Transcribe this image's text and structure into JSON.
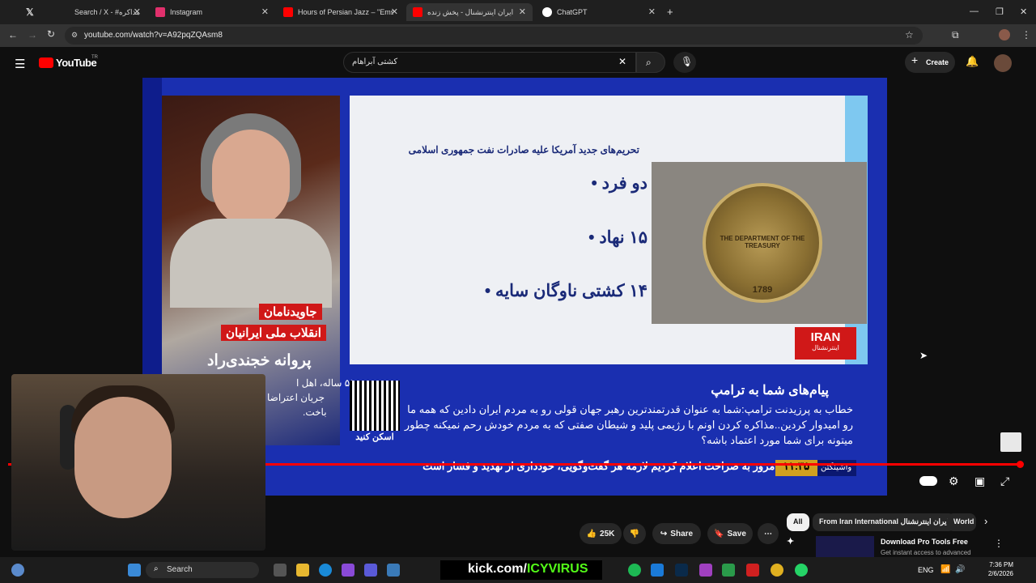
{
  "browser": {
    "tabs": [
      {
        "title": "Search / X - #مذاکره",
        "color": "#000000"
      },
      {
        "title": "Instagram",
        "color": "#e1306c"
      },
      {
        "title": "Hours of Persian Jazz – \"Emsha",
        "color": "#ff0000"
      },
      {
        "title": "ایران اینترنشنال - پخش زنده",
        "color": "#ff0000"
      },
      {
        "title": "ChatGPT",
        "color": "#ffffff"
      }
    ],
    "url": "youtube.com/watch?v=A92pqZQAsm8"
  },
  "youtube": {
    "logo": "YouTube",
    "region": "TR",
    "search_value": "کشتی آبراهام",
    "create_label": "Create"
  },
  "video": {
    "host_labels": [
      "جاویدنامان",
      "انقلاب ملی ایرانیان"
    ],
    "host_name": "پروانه خجندی‌راد",
    "host_caption": [
      "۵۱ ساله، اهل ا",
      "جریان اعتراضا",
      "باخت."
    ],
    "slide_subtitle": "تحریم‌های جدید آمریکا علیه صادرات نفت جمهوری اسلامی",
    "bullets": [
      "دو فرد •",
      "۱۵ نهاد •",
      "۱۴ کشتی ناوگان سایه •"
    ],
    "seal_text": "THE DEPARTMENT OF THE TREASURY",
    "seal_year": "1789",
    "channel_logo": "IRAN",
    "channel_sub": "اینترنشنال",
    "qr_label": "اسکن کنید",
    "message_title": "پیام‌های شما به ترامپ",
    "message_body": "خطاب به پرزیدنت ترامپ:شما به عنوان قدرتمندترین رهبر جهان قولی رو به مردم ایران دادین که همه ما رو امیدوار کردین..مذاکره کردن اونم با رژیمی پلید و شیطان صفتی که به مردم خودش رحم نمیکنه چطور میتونه برای شما مورد اعتماد باشه؟",
    "ticker_badge": "واشینگتن",
    "ticker_time": "۱۱:۳۵",
    "ticker_text": "عباس عراقچی: امروز به صراحت اعلام کردیم لازمه هر گفت‌وگویی، خودداری از تهدید و فشار است"
  },
  "actions": {
    "likes": "25K",
    "share": "Share",
    "save": "Save"
  },
  "chips": [
    "All",
    "From Iran International ایران اینترنشنال",
    "World"
  ],
  "ad": {
    "title": "Download Pro Tools Free",
    "subtitle": "Get instant access to advanced"
  },
  "taskbar": {
    "search_label": "Search",
    "kick_text": "kick.com/",
    "kick_user": "ICYVIRUS",
    "lang": "ENG",
    "time": "7:36 PM",
    "date": "2/6/2026"
  }
}
